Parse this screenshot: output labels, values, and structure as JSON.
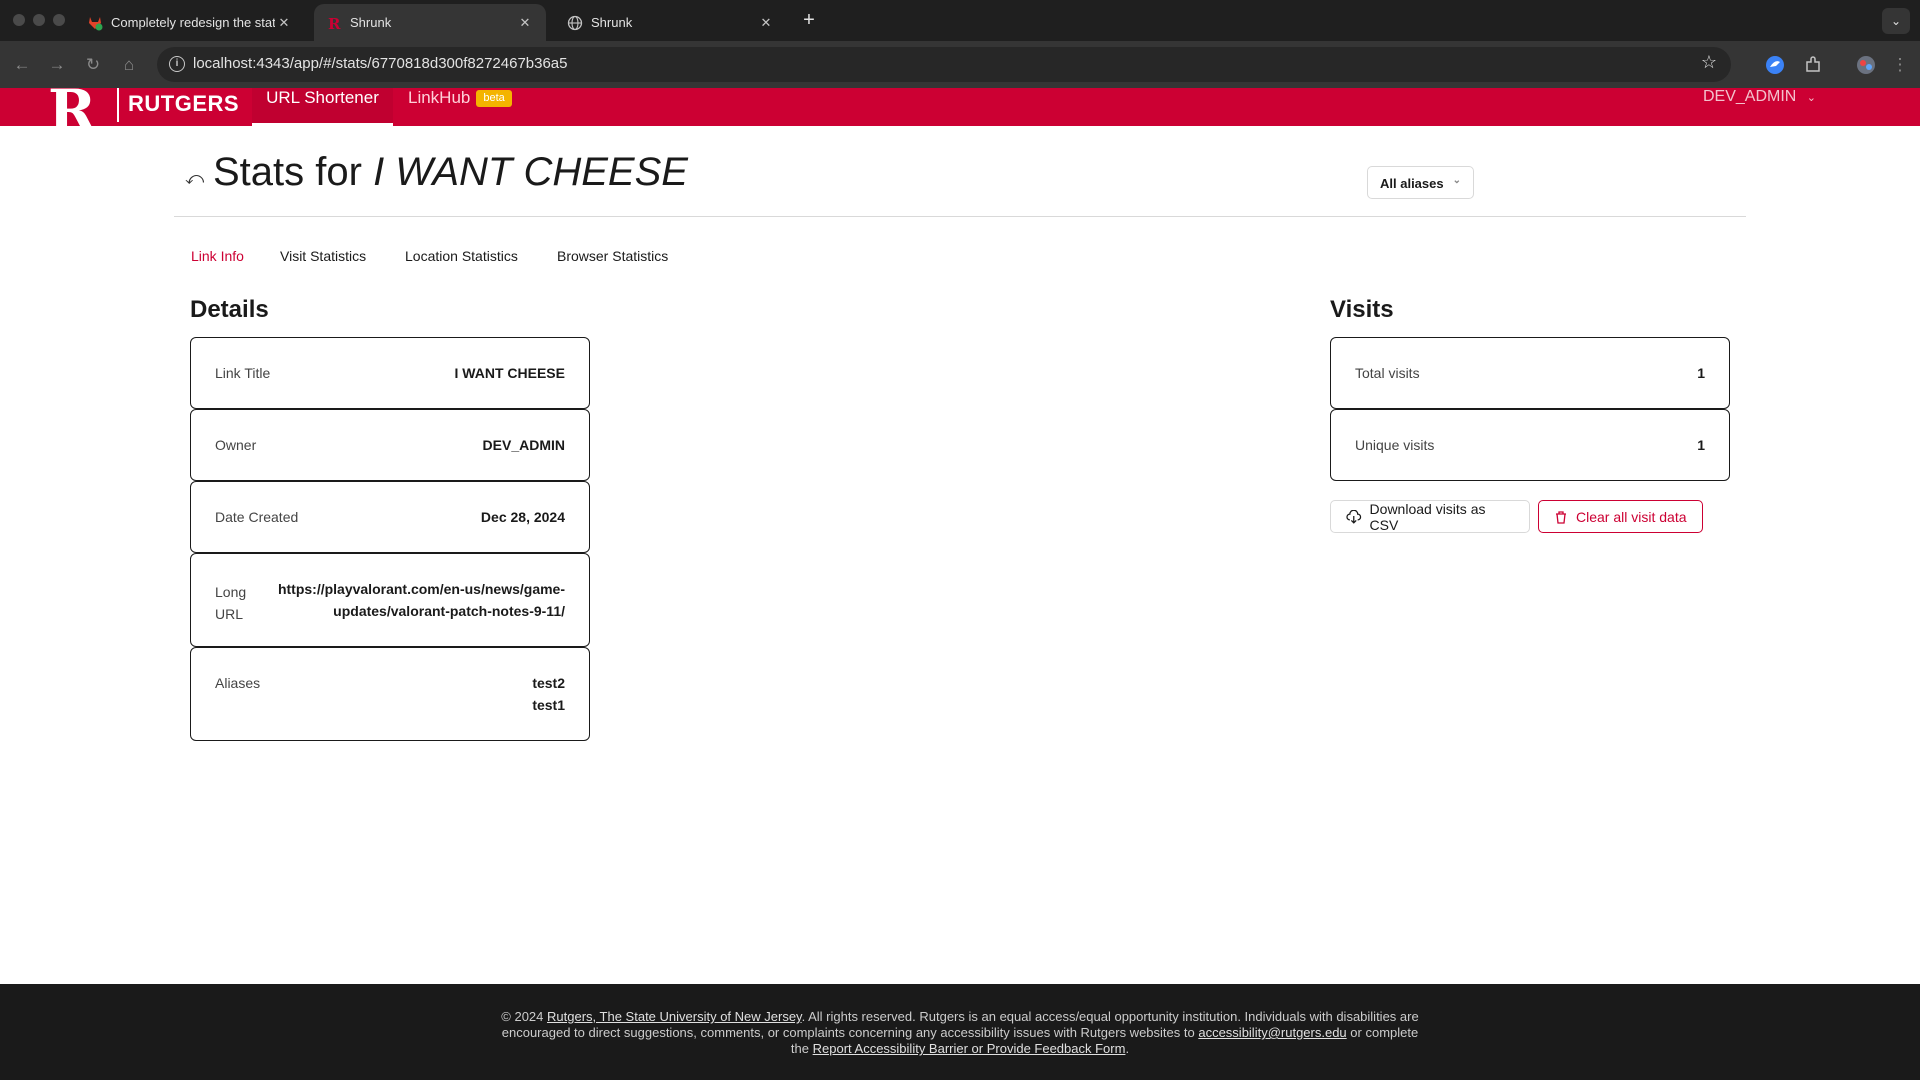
{
  "browser": {
    "tabs": [
      {
        "title": "Completely redesign the stat",
        "icon": "gitlab-fox-icon"
      },
      {
        "title": "Shrunk",
        "icon": "rutgers-r-icon"
      },
      {
        "title": "Shrunk",
        "icon": "globe-icon"
      }
    ],
    "url": "localhost:4343/app/#/stats/6770818d300f8272467b36a5"
  },
  "header": {
    "logo_letter": "R",
    "logo_text": "RUTGERS",
    "nav": [
      "URL Shortener",
      "LinkHub"
    ],
    "beta_badge": "beta",
    "user": "DEV_ADMIN"
  },
  "page": {
    "title_prefix": "Stats for",
    "title_link": "I WANT CHEESE",
    "alias_filter": "All aliases",
    "tabs": [
      "Link Info",
      "Visit Statistics",
      "Location Statistics",
      "Browser Statistics"
    ],
    "active_tab": "Link Info"
  },
  "details": {
    "heading": "Details",
    "rows": [
      {
        "label": "Link Title",
        "value": "I WANT CHEESE"
      },
      {
        "label": "Owner",
        "value": "DEV_ADMIN"
      },
      {
        "label": "Date Created",
        "value": "Dec 28, 2024"
      },
      {
        "label_line1": "Long",
        "label_line2": "URL",
        "value_line1": "https://playvalorant.com/en-us/news/game-",
        "value_line2": "updates/valorant-patch-notes-9-11/"
      },
      {
        "label": "Aliases",
        "values": [
          "test2",
          "test1"
        ]
      }
    ]
  },
  "visits": {
    "heading": "Visits",
    "total_label": "Total visits",
    "total_value": "1",
    "unique_label": "Unique visits",
    "unique_value": "1",
    "download_label": "Download visits as CSV",
    "clear_label": "Clear all visit data"
  },
  "footer": {
    "copyright": "© 2024",
    "univ_link": "Rutgers, The State University of New Jersey",
    "text1": ". All rights reserved. Rutgers is an equal access/equal opportunity institution. Individuals with disabilities are encouraged to direct suggestions, comments, or complaints concerning any accessibility issues with Rutgers websites to",
    "email_link": "accessibility@rutgers.edu",
    "text2": "or complete the",
    "form_link": "Report Accessibility Barrier or Provide Feedback Form",
    "text3": "."
  },
  "colors": {
    "brand_red": "#cc0033",
    "beta_yellow": "#f4b400",
    "footer_bg": "#1a1a1a"
  }
}
